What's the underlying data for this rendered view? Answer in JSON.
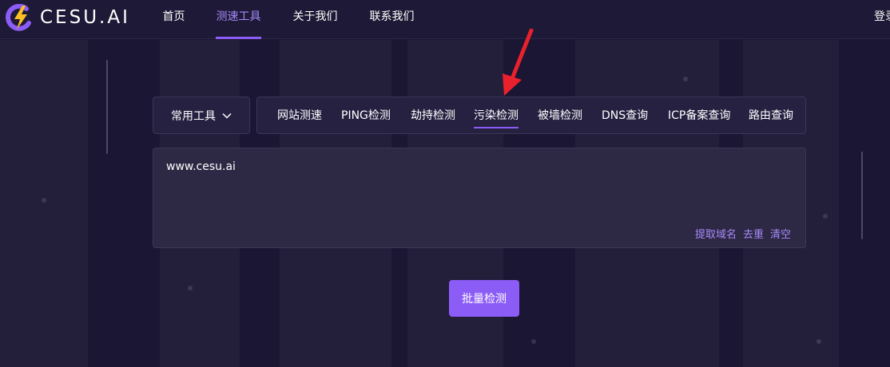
{
  "brand": {
    "name": "CESU.AI",
    "logo_icon": "lightning-c-logo",
    "accent_color": "#8b5cf6"
  },
  "nav": {
    "items": [
      {
        "label": "首页",
        "active": false
      },
      {
        "label": "测速工具",
        "active": true
      },
      {
        "label": "关于我们",
        "active": false
      },
      {
        "label": "联系我们",
        "active": false
      }
    ],
    "login_label": "登录"
  },
  "tools": {
    "dropdown_label": "常用工具",
    "tabs": [
      {
        "label": "网站测速",
        "active": false
      },
      {
        "label": "PING检测",
        "active": false
      },
      {
        "label": "劫持检测",
        "active": false
      },
      {
        "label": "污染检测",
        "active": true
      },
      {
        "label": "被墙检测",
        "active": false
      },
      {
        "label": "DNS查询",
        "active": false
      },
      {
        "label": "ICP备案查询",
        "active": false
      },
      {
        "label": "路由查询",
        "active": false
      }
    ]
  },
  "input": {
    "value": "www.cesu.ai",
    "actions": [
      "提取域名",
      "去重",
      "清空"
    ]
  },
  "submit_label": "批量检测",
  "annotation": {
    "icon": "red-arrow-icon",
    "color": "#e8212d"
  }
}
